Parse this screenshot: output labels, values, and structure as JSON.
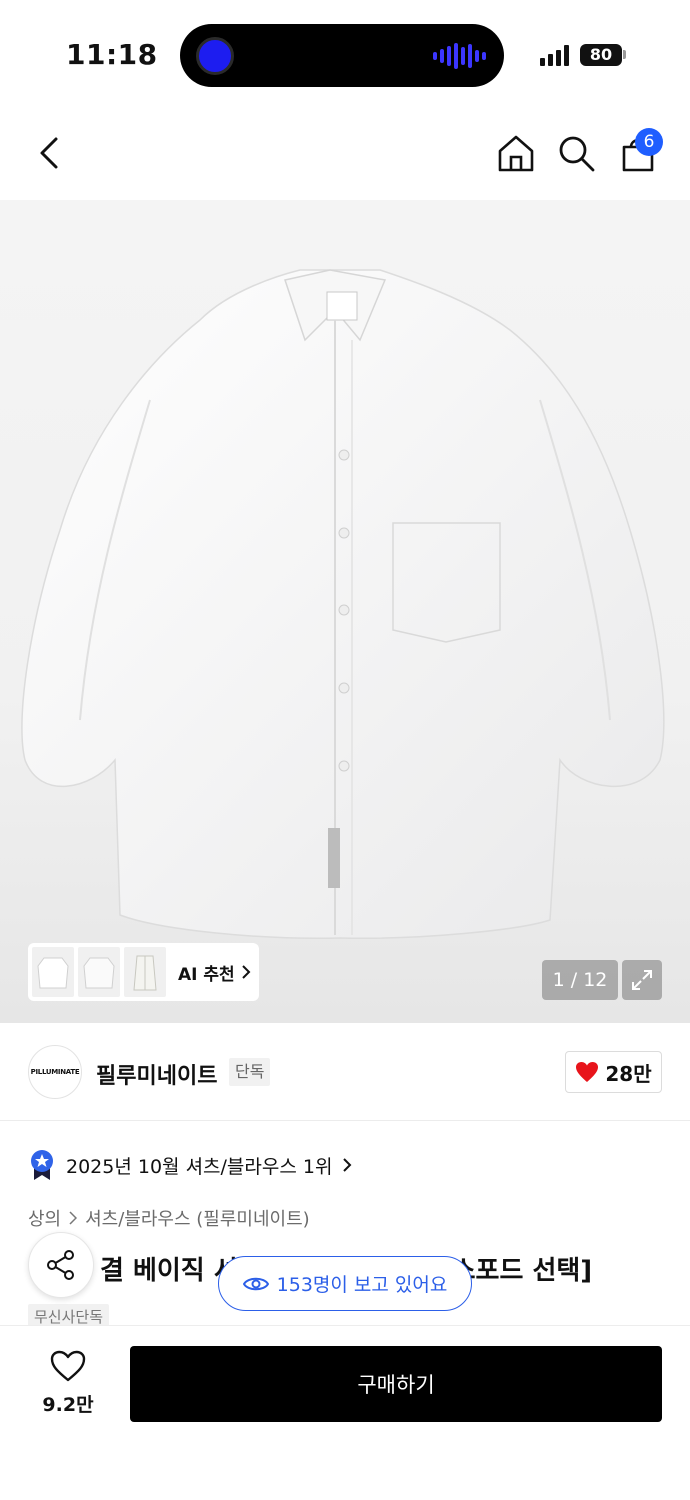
{
  "status_bar": {
    "time": "11:18",
    "battery": "80",
    "icons": [
      "dynamic-island",
      "signal-icon",
      "battery-icon"
    ]
  },
  "nav": {
    "icons": [
      "back-icon",
      "home-icon",
      "search-icon",
      "cart-icon"
    ],
    "cart_count": "6"
  },
  "gallery": {
    "ai_recommend_label": "AI 추천",
    "counter": "1 / 12",
    "background": "#f1f1f1"
  },
  "brand": {
    "logo_text": "PILLUMINATE",
    "name": "필루미네이트",
    "tag": "단독",
    "likes": "28만"
  },
  "ranking": {
    "text": "2025년 10월 셔츠/블라우스 1위"
  },
  "breadcrumb": {
    "level1": "상의",
    "level2": "셔츠/블라우스 (필루미네이트)"
  },
  "product": {
    "title_visible_left": "결 베이직 셔",
    "title_visible_right": "옥스포드 선택]",
    "store_tag": "무신사단독"
  },
  "viewers": {
    "text": "153명이 보고 있어요"
  },
  "bottom": {
    "wish_count": "9.2만",
    "buy_label": "구매하기"
  },
  "colors": {
    "accent_blue": "#2c5fe8",
    "cart_badge": "#1f5eff",
    "heart_red": "#e8141b",
    "buy_button": "#000000"
  }
}
